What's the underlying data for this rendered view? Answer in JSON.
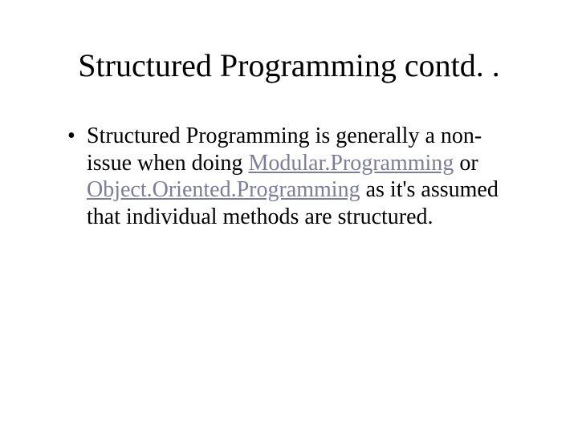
{
  "title": "Structured Programming contd. .",
  "bullet": {
    "part1": "Structured Programming is generally a non-issue when doing ",
    "link1": "Modular.Programming",
    "part2": " or ",
    "link2": "Object.Oriented.Programming",
    "part3": " as it's assumed that individual methods are structured."
  }
}
